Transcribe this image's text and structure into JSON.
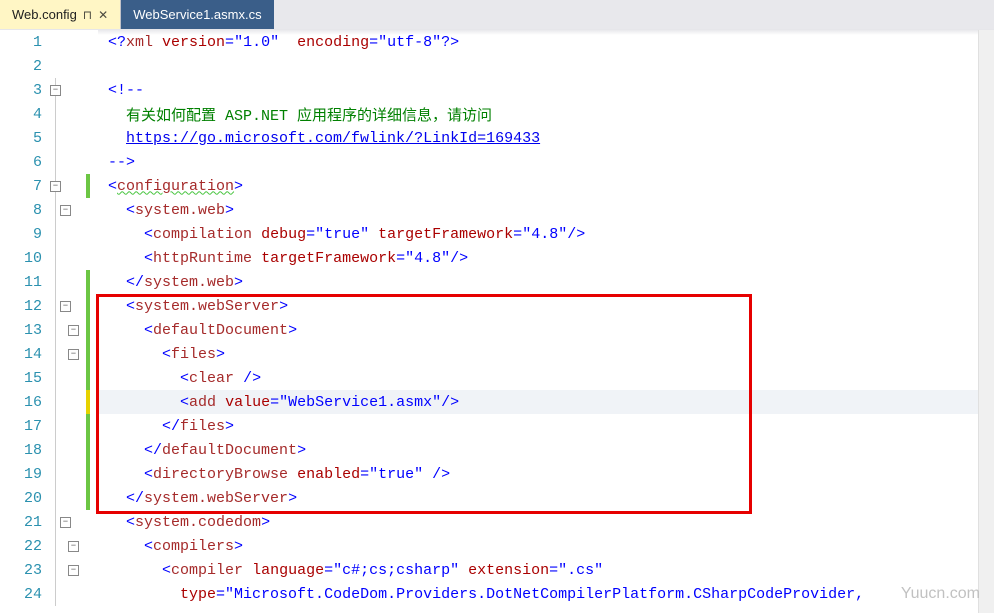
{
  "tabs": [
    {
      "label": "Web.config",
      "active": true
    },
    {
      "label": "WebService1.asmx.cs",
      "active": false
    }
  ],
  "watermark": "Yuucn.com",
  "lines": {
    "l1": {
      "num": "1"
    },
    "l2": {
      "num": "2"
    },
    "l3": {
      "num": "3"
    },
    "l4": {
      "num": "4"
    },
    "l5": {
      "num": "5"
    },
    "l6": {
      "num": "6"
    },
    "l7": {
      "num": "7"
    },
    "l8": {
      "num": "8"
    },
    "l9": {
      "num": "9"
    },
    "l10": {
      "num": "10"
    },
    "l11": {
      "num": "11"
    },
    "l12": {
      "num": "12"
    },
    "l13": {
      "num": "13"
    },
    "l14": {
      "num": "14"
    },
    "l15": {
      "num": "15"
    },
    "l16": {
      "num": "16"
    },
    "l17": {
      "num": "17"
    },
    "l18": {
      "num": "18"
    },
    "l19": {
      "num": "19"
    },
    "l20": {
      "num": "20"
    },
    "l21": {
      "num": "21"
    },
    "l22": {
      "num": "22"
    },
    "l23": {
      "num": "23"
    },
    "l24": {
      "num": "24"
    }
  },
  "code": {
    "xml_open": "<?",
    "xml": "xml ",
    "version_attr": "version",
    "version_val": "\"1.0\"",
    "encoding_attr": "encoding",
    "encoding_val": "\"utf-8\"",
    "xml_close": "?>",
    "comment_open": "<!--",
    "comment_text": "  有关如何配置 ASP.NET 应用程序的详细信息，请访问",
    "comment_link": "https://go.microsoft.com/fwlink/?LinkId=169433",
    "comment_close": "-->",
    "lt": "<",
    "gt": ">",
    "lts": "</",
    "sct": "/>",
    "eq": "=",
    "sp1": " ",
    "sp2": "  ",
    "sp3": "    ",
    "sp4": "      ",
    "sp5": "        ",
    "configuration": "configuration",
    "system_web": "system.web",
    "compilation": "compilation",
    "debug": "debug",
    "true_val": "\"true\"",
    "targetFramework": "targetFramework",
    "fw48": "\"4.8\"",
    "httpRuntime": "httpRuntime",
    "system_webServer": "system.webServer",
    "defaultDocument": "defaultDocument",
    "files": "files",
    "clear": "clear",
    "add": "add",
    "value_attr": "value",
    "ws_asmx": "\"WebService1.asmx\"",
    "directoryBrowse": "directoryBrowse",
    "enabled": "enabled",
    "system_codedom": "system.codedom",
    "compilers": "compilers",
    "compiler": "compiler",
    "language": "language",
    "lang_val": "\"c#;cs;csharp\"",
    "extension": "extension",
    "ext_val": "\".cs\"",
    "type_attr": "type",
    "type_val": "\"Microsoft.CodeDom.Providers.DotNetCompilerPlatform.CSharpCodeProvider,"
  }
}
